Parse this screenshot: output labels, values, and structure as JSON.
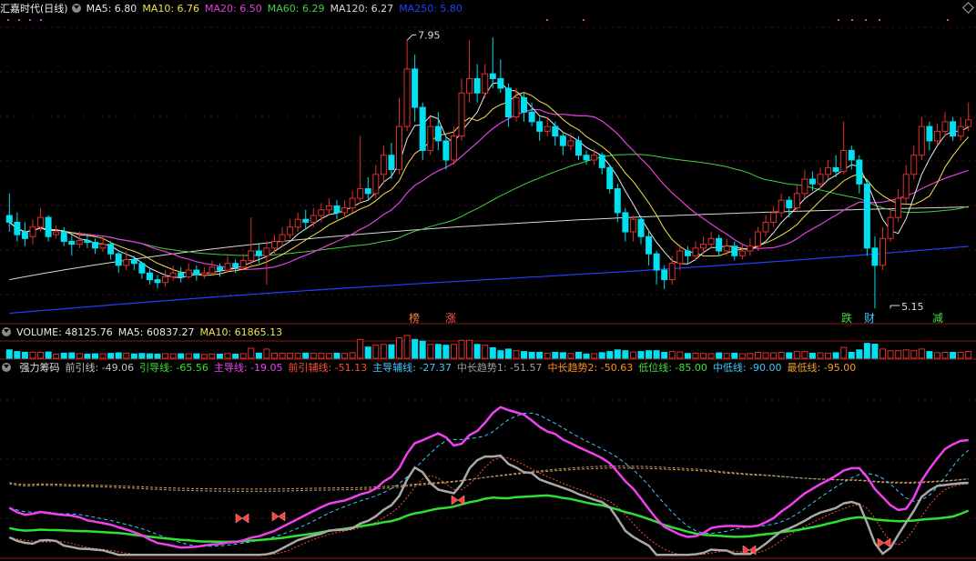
{
  "colors": {
    "bg": "#000000",
    "grid": "#5a1010",
    "up": "#e0302c",
    "down": "#00e0f0",
    "ma5": "#e8e8e8",
    "ma10": "#f2e24c",
    "ma20": "#e040e0",
    "ma60": "#40d040",
    "ma120": "#d8d8d8",
    "ma250": "#2040ff"
  },
  "main_legend": {
    "title": "汇嘉时代(日线)",
    "ma5": "MA5: 6.80",
    "ma10": "MA10: 6.76",
    "ma20": "MA20: 6.50",
    "ma60": "MA60: 6.29",
    "ma120": "MA120: 6.27",
    "ma250": "MA250: 5.80"
  },
  "vol_legend": {
    "volume": "VOLUME: 48125.76",
    "ma5": "MA5: 60837.27",
    "ma10": "MA10: 61865.13"
  },
  "ind_legend": [
    {
      "text": "强力筹码",
      "color": "#e0e0e0"
    },
    {
      "text": "前引线: -49.06",
      "color": "#c0c0c0"
    },
    {
      "text": "引导线: -65.56",
      "color": "#30e030"
    },
    {
      "text": "主导线: -19.05",
      "color": "#f040f0"
    },
    {
      "text": "前引辅线: -51.13",
      "color": "#ff5030"
    },
    {
      "text": "主导辅线: -27.37",
      "color": "#40c8ff"
    },
    {
      "text": "中长趋势1: -51.57",
      "color": "#a0a0a0"
    },
    {
      "text": "中长趋势2: -50.63",
      "color": "#ff9020"
    },
    {
      "text": "低位线: -85.00",
      "color": "#40e040"
    },
    {
      "text": "中低线: -90.00",
      "color": "#40c8ff"
    },
    {
      "text": "最低线: -95.00",
      "color": "#f0a030"
    }
  ],
  "annotations": {
    "high_label": "7.95",
    "low_label": "5.15",
    "markers": [
      "榜",
      "涨",
      "跌",
      "财",
      "减"
    ]
  },
  "chart_data": {
    "type": "candlestick",
    "title": "汇嘉时代(日线)",
    "ylim": [
      5.0,
      8.2
    ],
    "ohlc": [
      [
        6.12,
        6.05,
        6.35,
        5.95
      ],
      [
        6.05,
        5.92,
        6.15,
        5.85
      ],
      [
        5.95,
        5.88,
        6.05,
        5.8
      ],
      [
        5.9,
        6.0,
        6.08,
        5.82
      ],
      [
        6.0,
        6.1,
        6.2,
        5.95
      ],
      [
        6.1,
        5.9,
        6.12,
        5.85
      ],
      [
        5.92,
        5.95,
        6.02,
        5.88
      ],
      [
        5.95,
        5.85,
        6.0,
        5.8
      ],
      [
        5.85,
        5.82,
        5.92,
        5.7
      ],
      [
        5.82,
        5.86,
        5.95,
        5.78
      ],
      [
        5.86,
        5.84,
        5.92,
        5.78
      ],
      [
        5.84,
        5.78,
        5.88,
        5.72
      ],
      [
        5.78,
        5.82,
        5.9,
        5.74
      ],
      [
        5.82,
        5.72,
        5.85,
        5.66
      ],
      [
        5.72,
        5.6,
        5.74,
        5.52
      ],
      [
        5.6,
        5.66,
        5.75,
        5.55
      ],
      [
        5.66,
        5.62,
        5.7,
        5.55
      ],
      [
        5.62,
        5.52,
        5.64,
        5.46
      ],
      [
        5.52,
        5.45,
        5.56,
        5.4
      ],
      [
        5.45,
        5.42,
        5.5,
        5.36
      ],
      [
        5.42,
        5.48,
        5.55,
        5.38
      ],
      [
        5.48,
        5.52,
        5.6,
        5.44
      ],
      [
        5.52,
        5.48,
        5.58,
        5.42
      ],
      [
        5.48,
        5.55,
        5.62,
        5.46
      ],
      [
        5.55,
        5.5,
        5.6,
        5.44
      ],
      [
        5.5,
        5.52,
        5.58,
        5.46
      ],
      [
        5.52,
        5.58,
        5.65,
        5.5
      ],
      [
        5.58,
        5.55,
        5.62,
        5.48
      ],
      [
        5.55,
        5.62,
        5.7,
        5.52
      ],
      [
        5.62,
        5.58,
        5.66,
        5.52
      ],
      [
        5.58,
        5.65,
        5.72,
        5.55
      ],
      [
        5.65,
        5.75,
        6.1,
        5.6
      ],
      [
        5.75,
        5.7,
        5.82,
        5.62
      ],
      [
        5.7,
        5.78,
        5.85,
        5.4
      ],
      [
        5.78,
        5.85,
        5.92,
        5.72
      ],
      [
        5.85,
        5.92,
        6.0,
        5.8
      ],
      [
        5.92,
        6.0,
        6.08,
        5.88
      ],
      [
        6.0,
        6.08,
        6.15,
        5.95
      ],
      [
        6.08,
        6.05,
        6.18,
        5.98
      ],
      [
        6.05,
        6.12,
        6.2,
        6.0
      ],
      [
        6.12,
        6.18,
        6.25,
        6.05
      ],
      [
        6.18,
        6.22,
        6.3,
        6.12
      ],
      [
        6.22,
        6.15,
        6.28,
        6.08
      ],
      [
        6.15,
        6.2,
        6.28,
        6.1
      ],
      [
        6.2,
        6.3,
        6.38,
        6.15
      ],
      [
        6.3,
        6.4,
        6.95,
        6.25
      ],
      [
        6.4,
        6.35,
        6.52,
        6.28
      ],
      [
        6.35,
        6.55,
        6.65,
        6.3
      ],
      [
        6.55,
        6.75,
        6.85,
        6.45
      ],
      [
        6.75,
        6.6,
        6.88,
        6.5
      ],
      [
        6.6,
        7.05,
        7.35,
        6.55
      ],
      [
        7.05,
        7.65,
        7.95,
        7.0
      ],
      [
        7.65,
        7.25,
        7.8,
        7.1
      ],
      [
        7.25,
        6.8,
        7.3,
        6.7
      ],
      [
        6.8,
        7.05,
        7.15,
        6.75
      ],
      [
        7.05,
        6.9,
        7.2,
        6.8
      ],
      [
        6.9,
        6.7,
        6.95,
        6.6
      ],
      [
        6.7,
        6.95,
        7.05,
        6.65
      ],
      [
        6.95,
        7.4,
        7.55,
        6.9
      ],
      [
        7.4,
        7.55,
        7.95,
        7.3
      ],
      [
        7.55,
        7.4,
        7.7,
        7.3
      ],
      [
        7.4,
        7.6,
        7.7,
        7.35
      ],
      [
        7.6,
        7.55,
        7.98,
        7.45
      ],
      [
        7.55,
        7.45,
        7.75,
        7.4
      ],
      [
        7.45,
        7.15,
        7.5,
        7.05
      ],
      [
        7.15,
        7.35,
        7.45,
        7.1
      ],
      [
        7.35,
        7.2,
        7.4,
        7.1
      ],
      [
        7.2,
        7.1,
        7.3,
        7.05
      ],
      [
        7.1,
        7.0,
        7.15,
        6.9
      ],
      [
        7.0,
        7.05,
        7.15,
        6.95
      ],
      [
        7.05,
        6.95,
        7.1,
        6.85
      ],
      [
        6.95,
        6.85,
        6.98,
        6.75
      ],
      [
        6.85,
        6.9,
        6.98,
        6.8
      ],
      [
        6.9,
        6.75,
        6.95,
        6.7
      ],
      [
        6.75,
        6.7,
        6.8,
        6.65
      ],
      [
        6.7,
        6.75,
        6.82,
        6.65
      ],
      [
        6.75,
        6.62,
        6.78,
        6.55
      ],
      [
        6.62,
        6.4,
        6.65,
        6.35
      ],
      [
        6.4,
        6.15,
        6.45,
        6.05
      ],
      [
        6.15,
        5.95,
        6.2,
        5.85
      ],
      [
        5.95,
        6.08,
        6.12,
        5.85
      ],
      [
        6.08,
        5.9,
        6.12,
        5.82
      ],
      [
        5.9,
        5.72,
        5.95,
        5.6
      ],
      [
        5.72,
        5.55,
        5.75,
        5.4
      ],
      [
        5.55,
        5.45,
        5.6,
        5.35
      ],
      [
        5.45,
        5.62,
        5.7,
        5.4
      ],
      [
        5.62,
        5.75,
        5.82,
        5.55
      ],
      [
        5.75,
        5.7,
        5.8,
        5.62
      ],
      [
        5.7,
        5.78,
        5.85,
        5.65
      ],
      [
        5.78,
        5.82,
        5.9,
        5.72
      ],
      [
        5.82,
        5.88,
        5.95,
        5.78
      ],
      [
        5.88,
        5.75,
        5.92,
        5.7
      ],
      [
        5.75,
        5.8,
        5.88,
        5.7
      ],
      [
        5.8,
        5.7,
        5.85,
        5.65
      ],
      [
        5.7,
        5.75,
        5.82,
        5.66
      ],
      [
        5.75,
        5.8,
        5.88,
        5.7
      ],
      [
        5.8,
        5.95,
        6.0,
        5.75
      ],
      [
        5.95,
        6.05,
        6.12,
        5.9
      ],
      [
        6.05,
        6.15,
        6.22,
        6.0
      ],
      [
        6.15,
        6.28,
        6.35,
        6.1
      ],
      [
        6.28,
        6.2,
        6.32,
        6.1
      ],
      [
        6.2,
        6.35,
        6.45,
        6.15
      ],
      [
        6.35,
        6.5,
        6.6,
        6.3
      ],
      [
        6.5,
        6.45,
        6.58,
        6.38
      ],
      [
        6.45,
        6.55,
        6.62,
        6.4
      ],
      [
        6.55,
        6.62,
        6.7,
        6.5
      ],
      [
        6.62,
        6.58,
        6.75,
        6.52
      ],
      [
        6.58,
        6.8,
        7.1,
        6.55
      ],
      [
        6.8,
        6.7,
        6.85,
        6.6
      ],
      [
        6.7,
        6.45,
        6.75,
        6.35
      ],
      [
        6.45,
        5.78,
        6.5,
        5.7
      ],
      [
        5.78,
        5.6,
        5.9,
        5.15
      ],
      [
        5.6,
        5.88,
        6.0,
        5.55
      ],
      [
        5.88,
        6.1,
        6.2,
        5.85
      ],
      [
        6.1,
        6.3,
        6.4,
        6.05
      ],
      [
        6.3,
        6.55,
        6.65,
        6.25
      ],
      [
        6.55,
        6.75,
        6.85,
        6.5
      ],
      [
        6.75,
        7.05,
        7.15,
        6.7
      ],
      [
        7.05,
        6.9,
        7.1,
        6.8
      ],
      [
        6.9,
        7.0,
        7.08,
        6.85
      ],
      [
        7.0,
        7.1,
        7.2,
        6.95
      ],
      [
        7.1,
        6.95,
        7.15,
        6.9
      ],
      [
        6.95,
        7.05,
        7.15,
        6.9
      ],
      [
        7.05,
        7.12,
        7.3,
        7.0
      ]
    ],
    "indicator_lines": [
      "前引线",
      "引导线",
      "主导线",
      "前引辅线",
      "主导辅线",
      "中长趋势1",
      "中长趋势2"
    ]
  }
}
